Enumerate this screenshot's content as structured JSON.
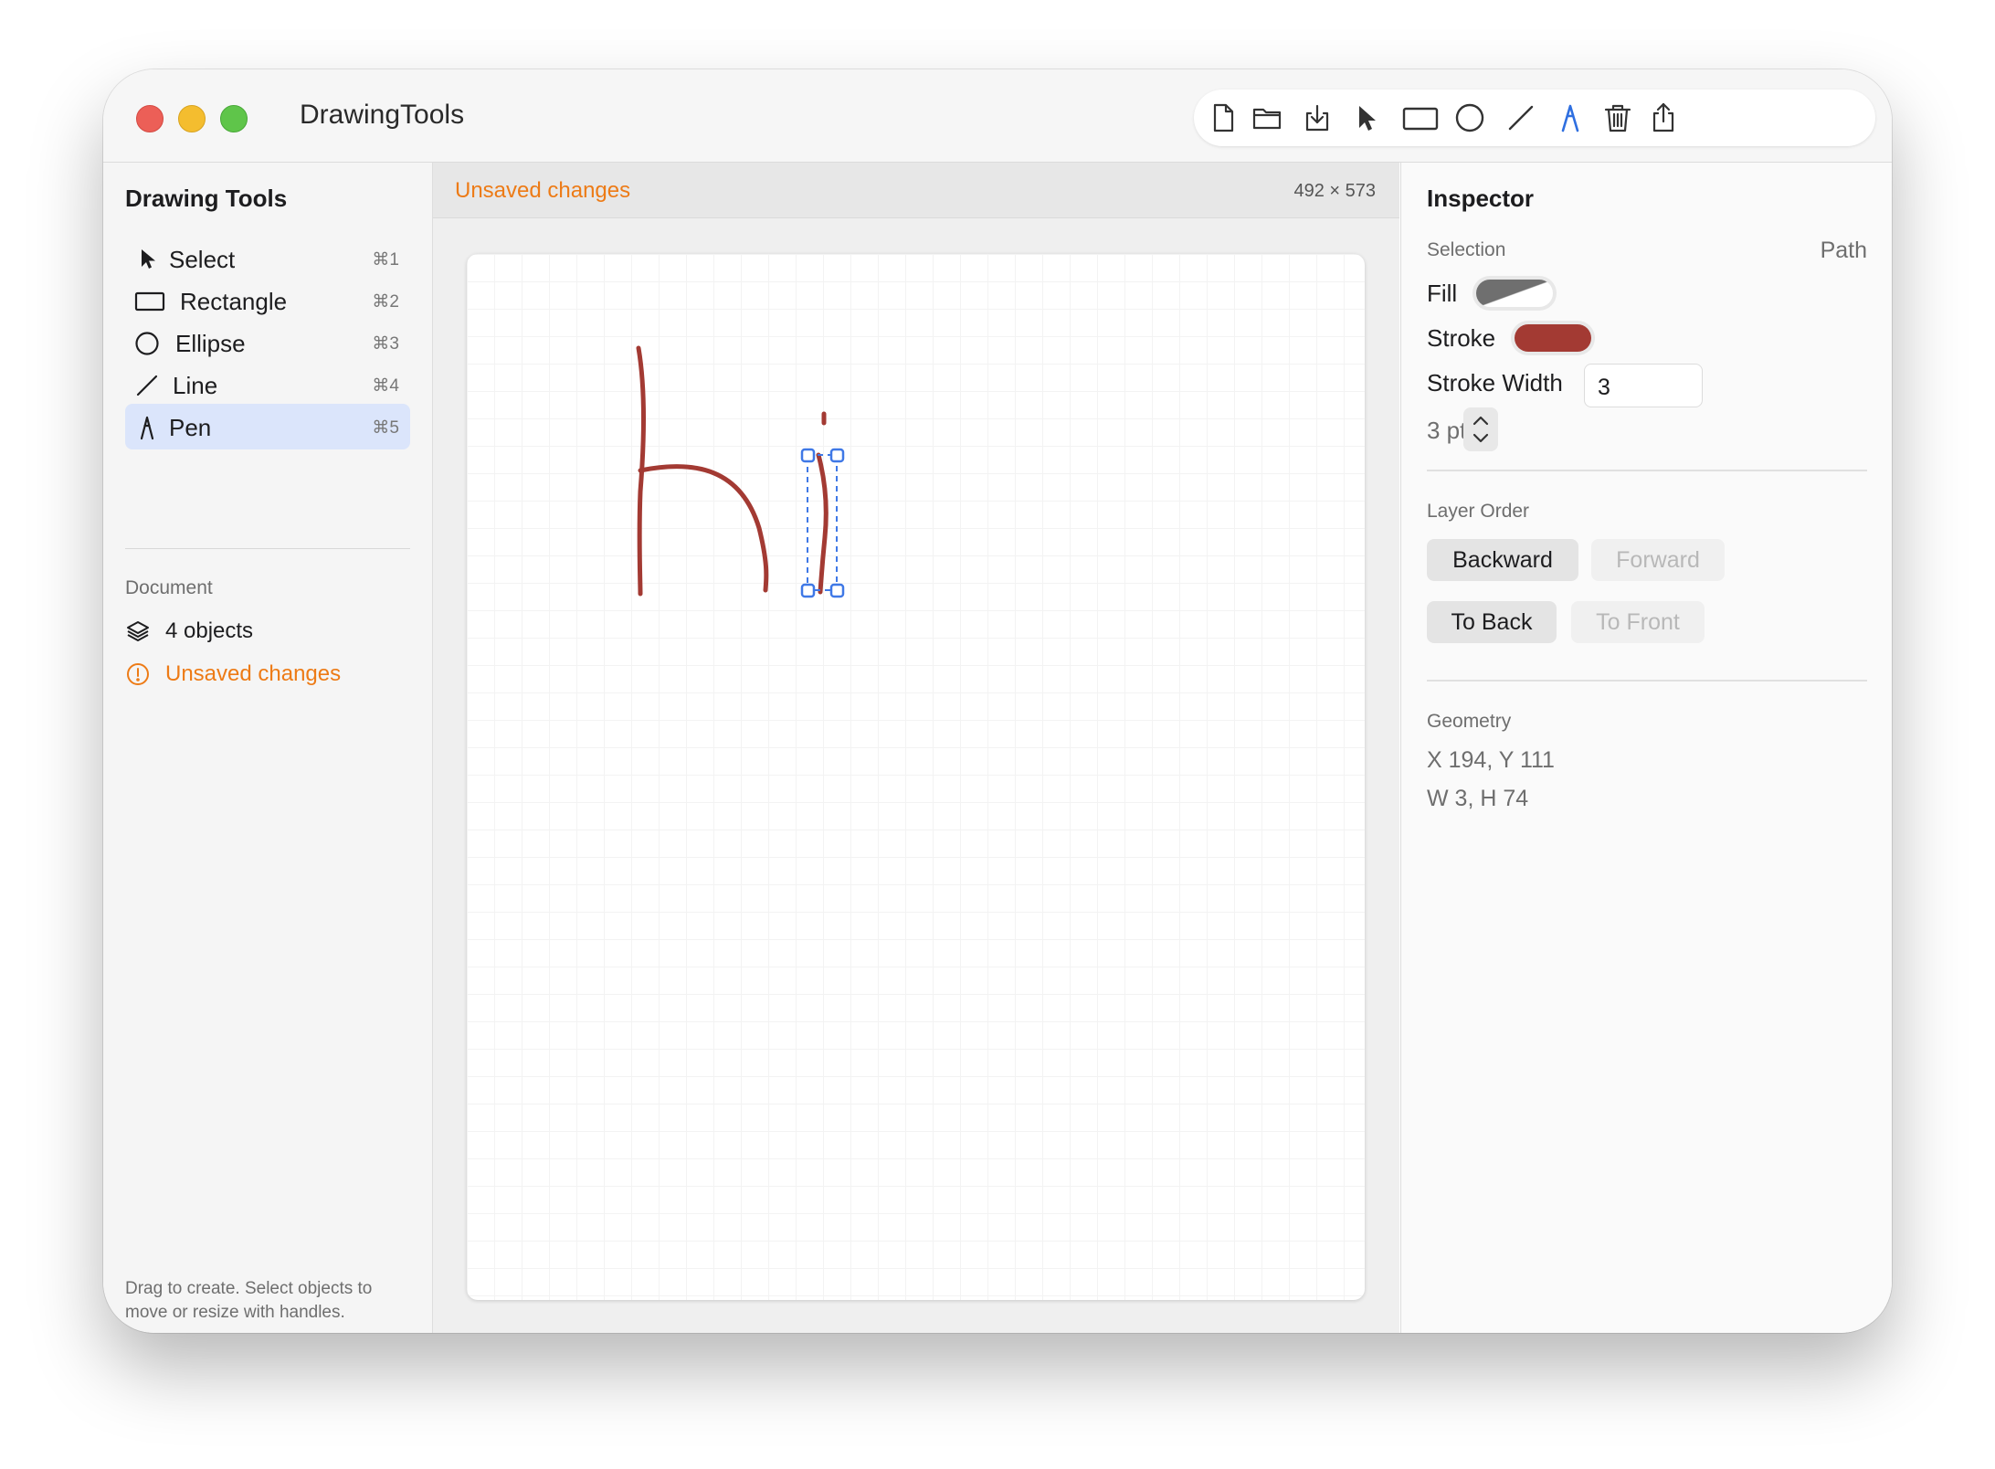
{
  "app": {
    "title": "DrawingTools"
  },
  "toolbar": {
    "buttons": [
      {
        "icon": "new-document-icon"
      },
      {
        "icon": "open-folder-icon"
      },
      {
        "icon": "save-download-icon"
      },
      {
        "icon": "pointer-icon"
      },
      {
        "icon": "rectangle-icon"
      },
      {
        "icon": "ellipse-icon"
      },
      {
        "icon": "line-icon"
      },
      {
        "icon": "pen-icon",
        "active": true
      },
      {
        "icon": "trash-icon"
      },
      {
        "icon": "share-icon"
      }
    ],
    "active_color": "#2f6fe0"
  },
  "sidebar": {
    "title": "Drawing Tools",
    "tools": [
      {
        "label": "Select",
        "shortcut": "⌘1",
        "icon": "pointer-icon"
      },
      {
        "label": "Rectangle",
        "shortcut": "⌘2",
        "icon": "rectangle-icon"
      },
      {
        "label": "Ellipse",
        "shortcut": "⌘3",
        "icon": "ellipse-icon"
      },
      {
        "label": "Line",
        "shortcut": "⌘4",
        "icon": "line-icon"
      },
      {
        "label": "Pen",
        "shortcut": "⌘5",
        "icon": "pen-icon",
        "active": true
      }
    ],
    "document_section": "Document",
    "objects_label": "4 objects",
    "unsaved_label": "Unsaved changes",
    "hint": "Drag to create. Select objects to move or resize with handles."
  },
  "canvas_header": {
    "status": "Unsaved changes",
    "size": "492 × 573"
  },
  "inspector": {
    "title": "Inspector",
    "selection_label": "Selection",
    "selection_value": "Path",
    "fill_label": "Fill",
    "stroke_label": "Stroke",
    "stroke_color": "#a33a33",
    "stroke_width_label": "Stroke Width",
    "stroke_width_value": "3",
    "stroke_pt": "3 pt",
    "layer_order_label": "Layer Order",
    "buttons": {
      "backward": "Backward",
      "forward": "Forward",
      "to_back": "To Back",
      "to_front": "To Front"
    },
    "geometry_label": "Geometry",
    "geometry_xy": "X 194, Y 111",
    "geometry_wh": "W 3, H 74"
  },
  "colors": {
    "accent": "#2f6fe0",
    "warning": "#ed7b16",
    "stroke": "#a33a33",
    "selection": "#3f78e6"
  }
}
